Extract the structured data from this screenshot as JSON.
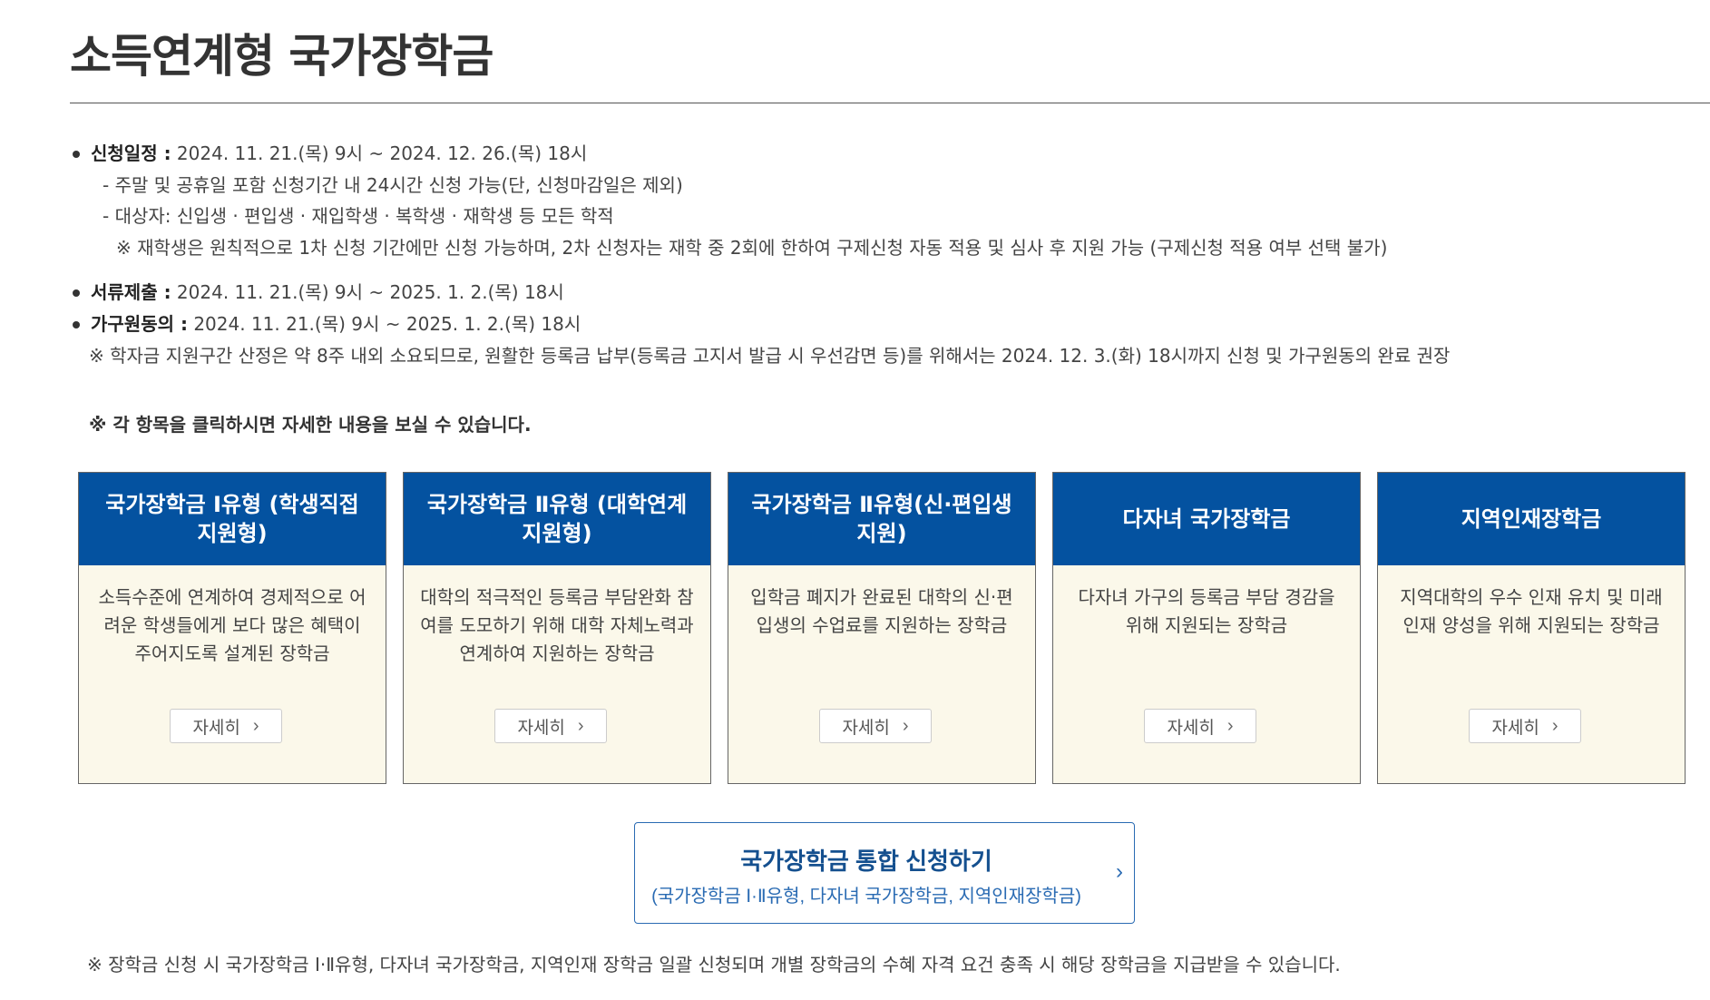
{
  "page": {
    "title": "소득연계형 국가장학금"
  },
  "schedule": {
    "apply_label": "신청일정 :",
    "apply_value": " 2024. 11. 21.(목) 9시 ~ 2024. 12. 26.(목) 18시",
    "apply_sub1": "- 주말 및 공휴일 포함 신청기간 내 24시간 신청 가능(단, 신청마감일은 제외)",
    "apply_sub2": "- 대상자: 신입생 · 편입생 · 재입학생 · 복학생 · 재학생 등 모든 학적",
    "apply_note": "※ 재학생은 원칙적으로 1차 신청 기간에만 신청 가능하며, 2차 신청자는 재학 중 2회에 한하여 구제신청 자동 적용 및 심사 후 지원 가능 (구제신청 적용 여부 선택 불가)",
    "docs_label": "서류제출 :",
    "docs_value": " 2024. 11. 21.(목) 9시 ~ 2025. 1. 2.(목) 18시",
    "consent_label": "가구원동의 :",
    "consent_value": " 2024. 11. 21.(목) 9시 ~ 2025. 1. 2.(목) 18시",
    "consent_note": "※ 학자금 지원구간 산정은 약 8주 내외 소요되므로, 원활한 등록금 납부(등록금 고지서 발급 시 우선감면 등)를 위해서는 2024. 12. 3.(화) 18시까지 신청 및 가구원동의 완료 권장"
  },
  "click_note": "※ 각 항목을 클릭하시면 자세한 내용을 보실 수 있습니다.",
  "cards": [
    {
      "title": "국가장학금 Ⅰ유형 (학생직접지원형)",
      "desc": "소득수준에 연계하여 경제적으로 어려운 학생들에게 보다 많은 혜택이 주어지도록 설계된 장학금",
      "button": "자세히"
    },
    {
      "title": "국가장학금 Ⅱ유형 (대학연계지원형)",
      "desc": "대학의 적극적인 등록금 부담완화 참여를 도모하기 위해 대학 자체노력과 연계하여 지원하는 장학금",
      "button": "자세히"
    },
    {
      "title": "국가장학금 Ⅱ유형(신·편입생지원)",
      "desc": "입학금 폐지가 완료된 대학의 신·편입생의 수업료를 지원하는 장학금",
      "button": "자세히"
    },
    {
      "title": "다자녀 국가장학금",
      "desc": "다자녀 가구의 등록금 부담 경감을 위해 지원되는 장학금",
      "button": "자세히"
    },
    {
      "title": "지역인재장학금",
      "desc": "지역대학의 우수 인재 유치 및 미래인재 양성을 위해 지원되는 장학금",
      "button": "자세히"
    }
  ],
  "apply": {
    "title": "국가장학금 통합 신청하기",
    "subtitle": "(국가장학금 Ⅰ·Ⅱ유형, 다자녀 국가장학금, 지역인재장학금)"
  },
  "bottom_note": "※ 장학금 신청 시 국가장학금 Ⅰ·Ⅱ유형, 다자녀 국가장학금, 지역인재 장학금 일괄 신청되며 개별 장학금의 수혜 자격 요건 충족 시 해당 장학금을 지급받을 수 있습니다.",
  "icons": {
    "bullet": "bullet-dot-icon",
    "chevron": "chevron-right-icon"
  },
  "colors": {
    "card_header": "#0452a0",
    "card_body": "#fbf8ea",
    "apply_border": "#2a6bb3",
    "apply_title": "#15508f"
  }
}
